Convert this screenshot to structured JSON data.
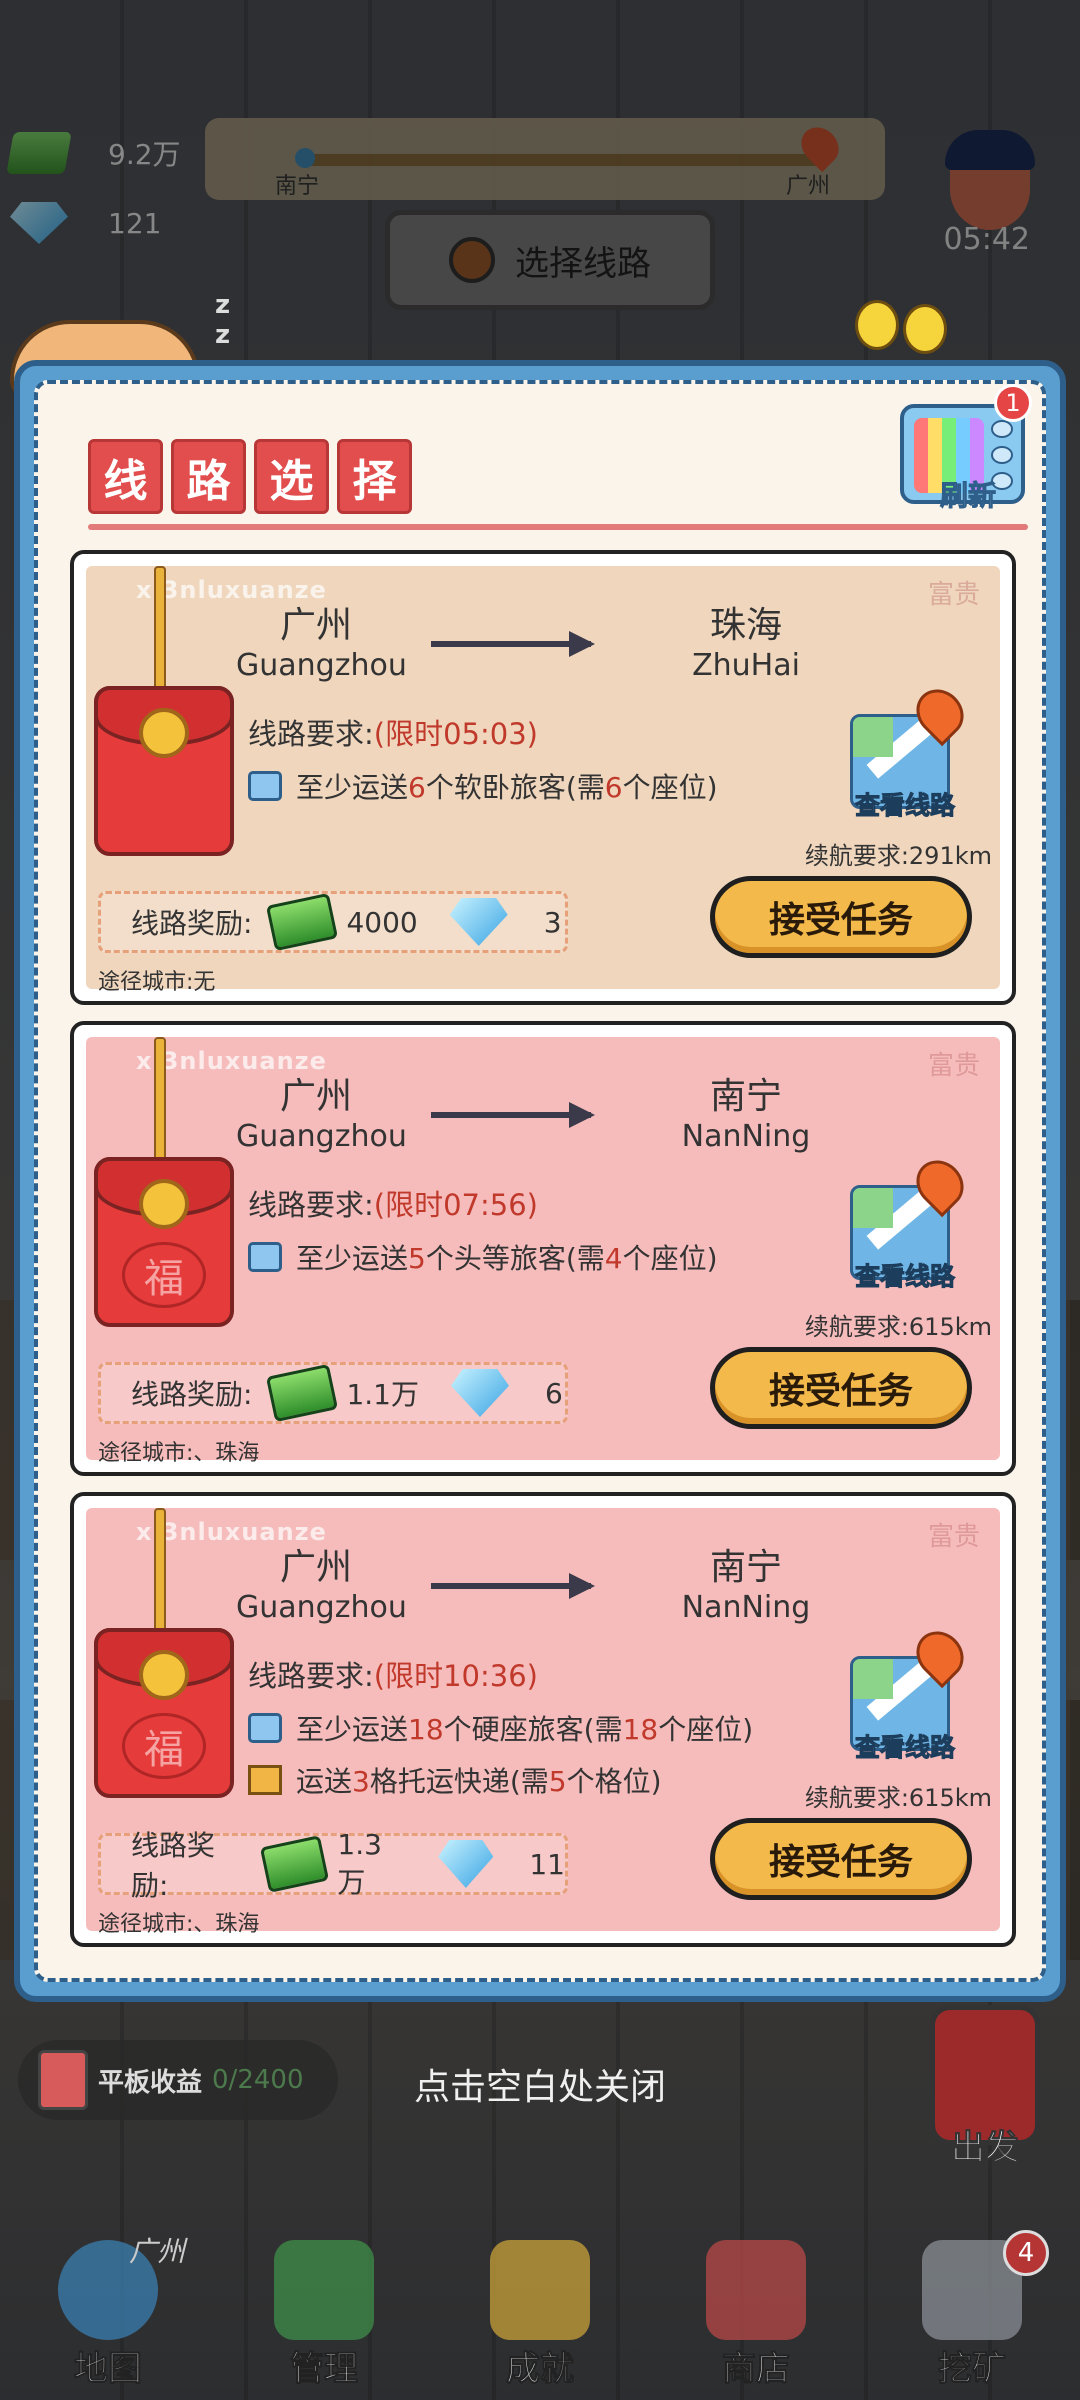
{
  "hud": {
    "cash": "9.2万",
    "gems": "121",
    "route_from": "南宁",
    "route_to": "广州",
    "select_route_label": "选择线路",
    "time": "05:42"
  },
  "modal": {
    "title_chars": [
      "线",
      "路",
      "选",
      "择"
    ],
    "refresh_label": "刷新",
    "refresh_badge": "1",
    "watermark": "xi3nluxuanze",
    "stamp": "富贵",
    "cards": [
      {
        "theme": "beige",
        "envelope": "plain",
        "from_cn": "广州",
        "from_en": "Guangzhou",
        "to_cn": "珠海",
        "to_en": "ZhuHai",
        "req_label": "线路要求:",
        "limit": "(限时05:03)",
        "req1_pre": "至少运送",
        "req1_num": "6",
        "req1_mid": "个软卧旅客(需",
        "req1_seats": "6",
        "req1_post": "个座位)",
        "map_label": "查看线路",
        "range": "续航要求:291km",
        "reward_label": "线路奖励:",
        "reward_cash": "4000",
        "reward_gems": "3",
        "accept_label": "接受任务",
        "via": "途径城市:无"
      },
      {
        "theme": "pink",
        "envelope": "fu",
        "fu": "福",
        "from_cn": "广州",
        "from_en": "Guangzhou",
        "to_cn": "南宁",
        "to_en": "NanNing",
        "req_label": "线路要求:",
        "limit": "(限时07:56)",
        "req1_pre": "至少运送",
        "req1_num": "5",
        "req1_mid": "个头等旅客(需",
        "req1_seats": "4",
        "req1_post": "个座位)",
        "map_label": "查看线路",
        "range": "续航要求:615km",
        "reward_label": "线路奖励:",
        "reward_cash": "1.1万",
        "reward_gems": "6",
        "accept_label": "接受任务",
        "via": "途径城市:、珠海"
      },
      {
        "theme": "pink",
        "envelope": "fu",
        "fu": "福",
        "from_cn": "广州",
        "from_en": "Guangzhou",
        "to_cn": "南宁",
        "to_en": "NanNing",
        "req_label": "线路要求:",
        "limit": "(限时10:36)",
        "req1_pre": "至少运送",
        "req1_num": "18",
        "req1_mid": "个硬座旅客(需",
        "req1_seats": "18",
        "req1_post": "个座位)",
        "req2_pre": "运送",
        "req2_num": "3",
        "req2_mid": "格托运快递(需",
        "req2_slots": "5",
        "req2_post": "个格位)",
        "map_label": "查看线路",
        "range": "续航要求:615km",
        "reward_label": "线路奖励:",
        "reward_cash": "1.3万",
        "reward_gems": "11",
        "accept_label": "接受任务",
        "via": "途径城市:、珠海"
      }
    ]
  },
  "close_hint": "点击空白处关闭",
  "tablet": {
    "label": "平板收益",
    "progress": "0/2400"
  },
  "depart_label": "出发",
  "tabs": [
    {
      "label": "地图",
      "icon": "globe-pin-icon",
      "tag": "广州"
    },
    {
      "label": "管理",
      "icon": "train-icon"
    },
    {
      "label": "成就",
      "icon": "star-icon"
    },
    {
      "label": "商店",
      "icon": "shop-cart-icon"
    },
    {
      "label": "挖矿",
      "icon": "pickaxe-icon",
      "badge": "4"
    }
  ],
  "colors": {
    "modal_frame": "#5a9ed0",
    "title_red": "#e24e4e",
    "accept_yellow": "#f3b94a",
    "limit_red": "#c0392b",
    "card_beige": "#efd6bd",
    "card_pink": "#f6bcbc"
  }
}
